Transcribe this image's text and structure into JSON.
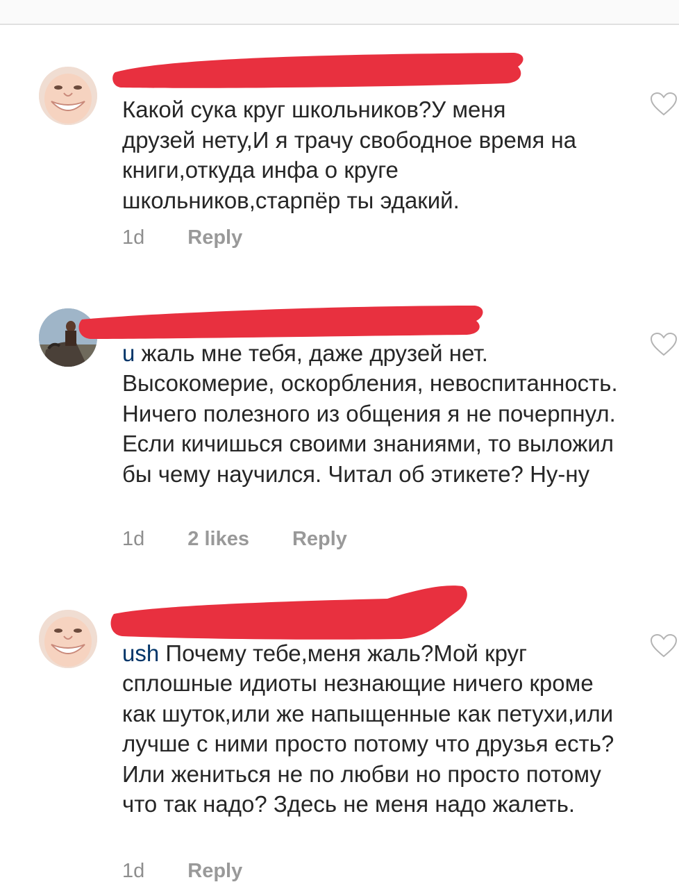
{
  "comments": [
    {
      "avatar": "smiling-face-avatar",
      "username": "",
      "text": "Какой сука круг школьников?У меня друзей нету,И я трачу свободное время на книги,откуда инфа о круге школьников,старпёр ты эдакий.",
      "time": "1d",
      "likes": "",
      "reply": "Reply"
    },
    {
      "avatar": "rider-on-horse-avatar",
      "mention_tail": "u",
      "text": " жаль мне тебя, даже друзей нет. Высокомерие, оскорбления, невоспитанность. Ничего полезного из общения я не почерпнул. Если кичишься своими знаниями, то выложил бы чему научился. Читал об этикете? Ну-ну",
      "time": "1d",
      "likes": "2 likes",
      "reply": "Reply"
    },
    {
      "avatar": "smiling-face-avatar",
      "mention_tail": "ush",
      "text": " Почему тебе,меня жаль?Мой круг сплошные идиоты незнающие ничего кроме как шуток,или же напыщенные как петухи,или лучше с ними просто потому что друзья есть?Или жениться не по любви но просто потому что так надо? Здесь не меня надо жалеть.",
      "time": "1d",
      "likes": "",
      "reply": "Reply"
    }
  ],
  "colors": {
    "redaction": "#e8303f",
    "mention": "#003569",
    "meta": "#8e8e8e"
  },
  "icons": {
    "like": "heart-outline-icon"
  }
}
